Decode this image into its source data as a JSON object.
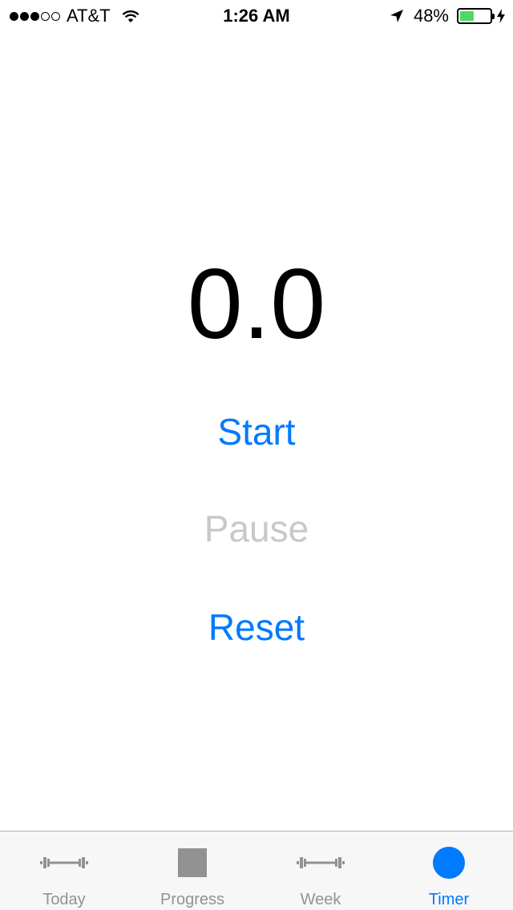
{
  "status_bar": {
    "carrier": "AT&T",
    "time": "1:26 AM",
    "battery_percent_label": "48%",
    "battery_level": 0.48,
    "signal_strength": 3,
    "signal_max": 5,
    "icons": [
      "wifi-icon",
      "location-arrow-icon",
      "battery-icon",
      "charging-bolt-icon"
    ]
  },
  "timer": {
    "value": "0.0"
  },
  "actions": {
    "start_label": "Start",
    "pause_label": "Pause",
    "reset_label": "Reset"
  },
  "tabs": [
    {
      "label": "Today",
      "icon": "barbell-icon",
      "active": false
    },
    {
      "label": "Progress",
      "icon": "square-icon",
      "active": false
    },
    {
      "label": "Week",
      "icon": "barbell-icon",
      "active": false
    },
    {
      "label": "Timer",
      "icon": "circle-icon",
      "active": true
    }
  ],
  "colors": {
    "accent": "#007aff",
    "disabled": "#c8c8cc",
    "tab_inactive": "#929292",
    "battery": "#4cd964"
  }
}
